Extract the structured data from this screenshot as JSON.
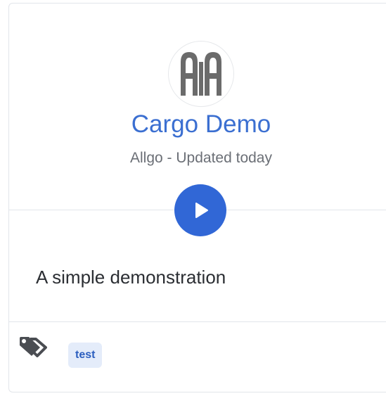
{
  "card": {
    "title": "Cargo Demo",
    "author": "Allgo",
    "separator": " - ",
    "updated": "Updated today",
    "description": "A simple demonstration",
    "logo_text": "AA"
  },
  "tags": [
    "test"
  ],
  "colors": {
    "accent": "#3167d6",
    "title": "#3b6fd1",
    "muted": "#6b6f76",
    "tag_bg": "#e4ecfa"
  },
  "icons": {
    "logo": "allgo-logo",
    "play": "play-icon",
    "tags": "tags-icon"
  }
}
